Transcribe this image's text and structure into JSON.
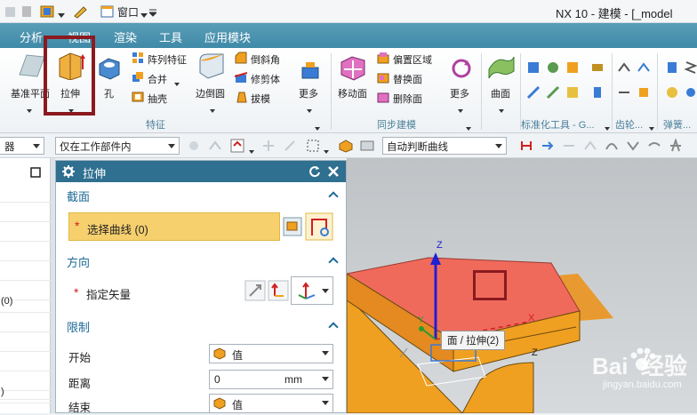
{
  "titlebar": {
    "window_menu": "窗口",
    "title": "NX 10 - 建模 - [_model"
  },
  "menubar": {
    "tabs": [
      "分析",
      "视图",
      "渲染",
      "工具",
      "应用模块"
    ]
  },
  "ribbon": {
    "datum_plane": "基准平面",
    "extrude": "拉伸",
    "hole": "孔",
    "pattern_feature": "阵列特征",
    "unite": "合并",
    "shell": "抽壳",
    "edge_blend": "边倒圆",
    "chamfer": "倒斜角",
    "trim_body": "修剪体",
    "draft": "拔模",
    "more_1": "更多",
    "feature_group": "特征",
    "move_face": "移动面",
    "offset_region": "偏置区域",
    "replace_face": "替换面",
    "delete_face": "删除面",
    "more_2": "更多",
    "sync_group": "同步建模",
    "surface": "曲面",
    "std_group": "标准化工具 - G...",
    "gear_group": "齿轮...",
    "spring_group": "弹簧..."
  },
  "toolbar2": {
    "filter_left": "器",
    "scope": "仅在工作部件内",
    "curve_rule": "自动判断曲线"
  },
  "leftnav": {
    "rows": [
      "",
      "",
      "",
      "",
      "",
      "",
      "(0)",
      "",
      "",
      "",
      "",
      "",
      ")"
    ]
  },
  "dialog": {
    "title": "拉伸",
    "section": {
      "header": "截面",
      "select_curve": "选择曲线 (0)"
    },
    "direction": {
      "header": "方向",
      "specify_vector": "指定矢量"
    },
    "limits": {
      "header": "限制",
      "start_label": "开始",
      "start_value": "值",
      "distance_label": "距离",
      "distance_value": "0",
      "distance_unit": "mm",
      "end_label": "结束",
      "end_value": "值"
    }
  },
  "viewport": {
    "tooltip": "面 / 拉伸(2)",
    "axis_z": "Z",
    "axis_x": "X",
    "axis_y": "Y",
    "axis_z2": "Z"
  },
  "watermark": {
    "logo": "Bai  经验",
    "url": "jingyan.baidu.com"
  },
  "colors": {
    "accent": "#2f6f8f",
    "face": "#f0665e",
    "body": "#f0a020",
    "highlight": "#8b1a20",
    "selection_bg": "#f7d06e"
  }
}
